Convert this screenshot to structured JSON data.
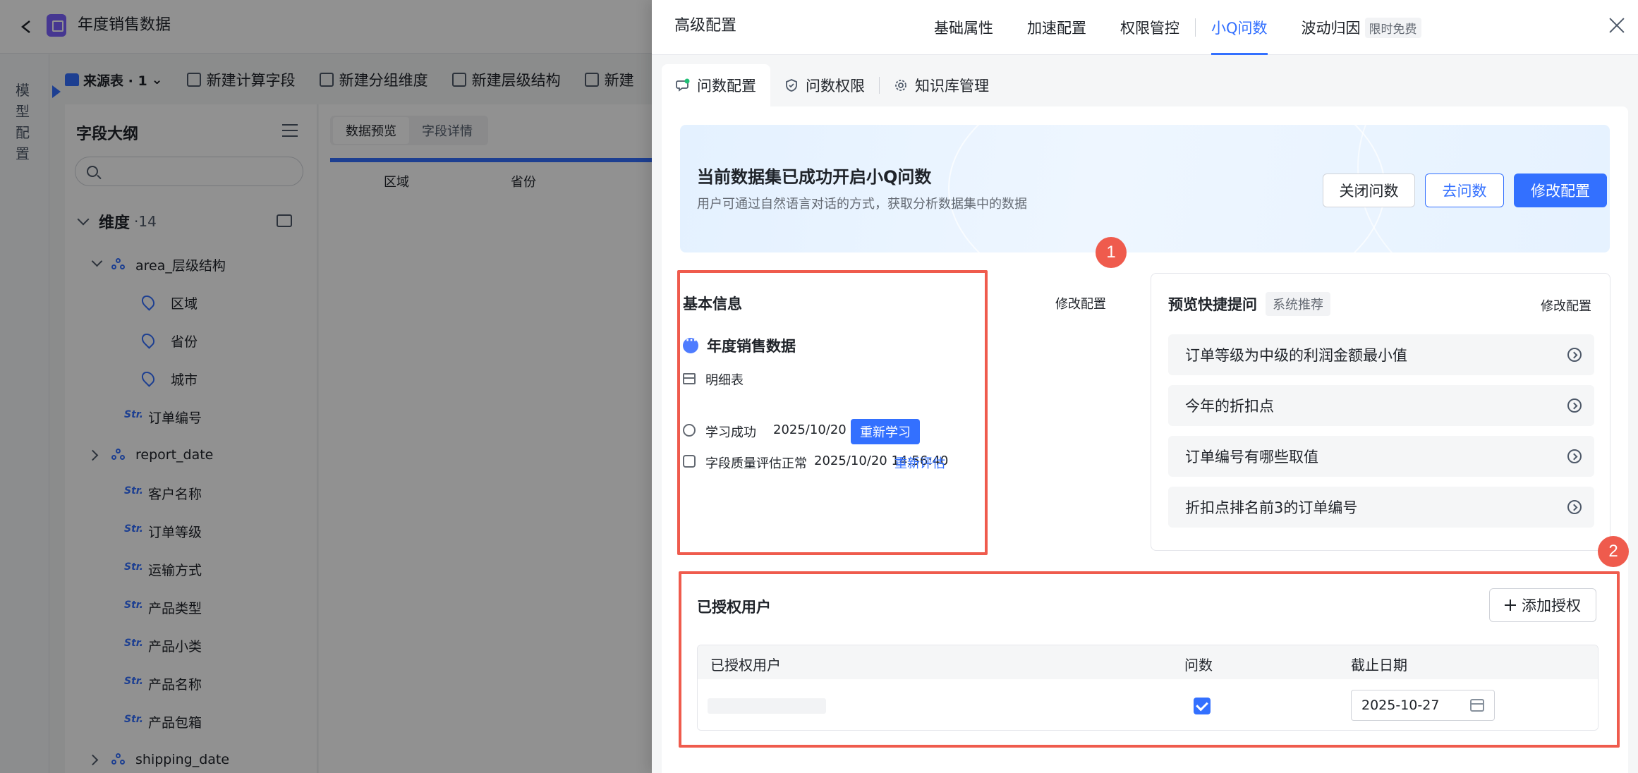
{
  "app": {
    "title": "年度销售数据"
  },
  "left_rail": {
    "label": "模型配置"
  },
  "toolbar": {
    "source": "来源表 · 1",
    "items": [
      "新建计算字段",
      "新建分组维度",
      "新建层级结构",
      "新建"
    ]
  },
  "outline": {
    "title": "字段大纲",
    "search_placeholder": "",
    "dimension_label": "维度",
    "dimension_count": "·14",
    "tree": [
      {
        "label": "area_层级结构",
        "type": "hierarchy",
        "expanded": true
      },
      {
        "label": "区域",
        "type": "geo"
      },
      {
        "label": "省份",
        "type": "geo"
      },
      {
        "label": "城市",
        "type": "geo"
      },
      {
        "label": "订单编号",
        "type": "str"
      },
      {
        "label": "report_date",
        "type": "hierarchy",
        "expanded": false
      },
      {
        "label": "客户名称",
        "type": "str"
      },
      {
        "label": "订单等级",
        "type": "str"
      },
      {
        "label": "运输方式",
        "type": "str"
      },
      {
        "label": "产品类型",
        "type": "str"
      },
      {
        "label": "产品小类",
        "type": "str"
      },
      {
        "label": "产品名称",
        "type": "str"
      },
      {
        "label": "产品包箱",
        "type": "str"
      },
      {
        "label": "shipping_date",
        "type": "hierarchy",
        "expanded": false
      }
    ],
    "str_tag": "Str."
  },
  "preview": {
    "tabs": [
      "数据预览",
      "字段详情"
    ],
    "columns": [
      "区域",
      "省份"
    ]
  },
  "drawer": {
    "title": "高级配置",
    "tabs": [
      {
        "label": "基础属性",
        "active": false
      },
      {
        "label": "加速配置",
        "active": false
      },
      {
        "label": "权限管控",
        "active": false
      },
      {
        "label": "小Q问数",
        "active": true
      },
      {
        "label": "波动归因",
        "active": false
      }
    ],
    "free_badge": "限时免费",
    "sub_tabs": [
      "问数配置",
      "问数权限",
      "知识库管理"
    ],
    "banner": {
      "title": "当前数据集已成功开启小Q问数",
      "subtitle": "用户可通过自然语言对话的方式，获取分析数据集中的数据",
      "close_button": "关闭问数",
      "go_button": "去问数",
      "edit_button": "修改配置"
    },
    "basic_info": {
      "title": "基本信息",
      "edit_link": "修改配置",
      "dataset_name": "年度销售数据",
      "table_type": "明细表",
      "learn_status": "学习成功",
      "learn_time": "2025/10/20 14:56:19",
      "relearn_button": "重新学习",
      "quality_status": "字段质量评估正常",
      "quality_time": "2025/10/20 14:56:40",
      "reevaluate_link": "重新评估"
    },
    "quick_questions": {
      "title": "预览快捷提问",
      "tag": "系统推荐",
      "edit_link": "修改配置",
      "items": [
        "订单等级为中级的利润金额最小值",
        "今年的折扣点",
        "订单编号有哪些取值",
        "折扣点排名前3的订单编号"
      ]
    },
    "authorized_users": {
      "title": "已授权用户",
      "add_button": "添加授权",
      "columns": [
        "已授权用户",
        "问数",
        "截止日期"
      ],
      "rows": [
        {
          "user": "",
          "ask_enabled": true,
          "end_date": "2025-10-27"
        }
      ]
    },
    "annotations": [
      "1",
      "2"
    ]
  },
  "colors": {
    "primary": "#3370ff",
    "annotation": "#ef5b4d",
    "overlay": "rgba(0,0,0,0.43)"
  }
}
